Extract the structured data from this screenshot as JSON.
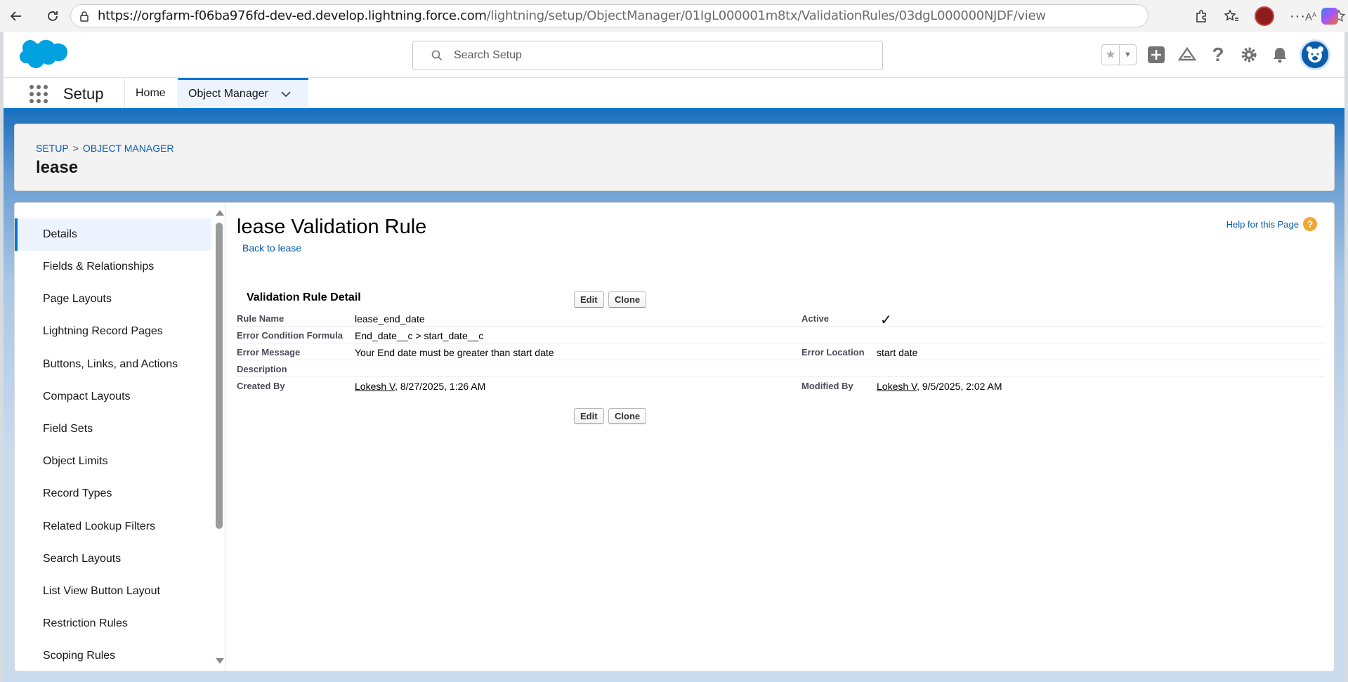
{
  "browser": {
    "url_host": "https://orgfarm-f06ba976fd-dev-ed.develop.lightning.force.com",
    "url_path": "/lightning/setup/ObjectManager/01IgL000001m8tx/ValidationRules/03dgL000000NJDF/view"
  },
  "header": {
    "search_placeholder": "Search Setup"
  },
  "nav": {
    "app_name": "Setup",
    "tabs": [
      {
        "label": "Home"
      },
      {
        "label": "Object Manager"
      }
    ]
  },
  "breadcrumb": {
    "setup": "SETUP",
    "separator": ">",
    "object_manager": "OBJECT MANAGER",
    "title": "lease"
  },
  "sidebar": {
    "items": [
      {
        "label": "Details",
        "active": true
      },
      {
        "label": "Fields & Relationships"
      },
      {
        "label": "Page Layouts"
      },
      {
        "label": "Lightning Record Pages"
      },
      {
        "label": "Buttons, Links, and Actions"
      },
      {
        "label": "Compact Layouts"
      },
      {
        "label": "Field Sets"
      },
      {
        "label": "Object Limits"
      },
      {
        "label": "Record Types"
      },
      {
        "label": "Related Lookup Filters"
      },
      {
        "label": "Search Layouts"
      },
      {
        "label": "List View Button Layout"
      },
      {
        "label": "Restriction Rules"
      },
      {
        "label": "Scoping Rules"
      }
    ]
  },
  "detail": {
    "title": "lease Validation Rule",
    "back_link": "Back to lease",
    "help_link": "Help for this Page",
    "section_title": "Validation Rule Detail",
    "edit_label": "Edit",
    "clone_label": "Clone",
    "fields": {
      "rule_name_label": "Rule Name",
      "rule_name": "lease_end_date",
      "active_label": "Active",
      "active_mark": "✓",
      "formula_label": "Error Condition Formula",
      "formula": "End_date__c > start_date__c",
      "error_message_label": "Error Message",
      "error_message": "Your End date must be greater than start date",
      "error_location_label": "Error Location",
      "error_location": "start date",
      "description_label": "Description",
      "created_by_label": "Created By",
      "created_by_user": "Lokesh V",
      "created_by_date": ", 8/27/2025, 1:26 AM",
      "modified_by_label": "Modified By",
      "modified_by_user": "Lokesh V",
      "modified_by_date": ", 9/5/2025, 2:02 AM"
    }
  },
  "colors": {
    "brand_blue": "#0176d3",
    "link_blue": "#015ba7",
    "help_orange": "#f2a633"
  }
}
